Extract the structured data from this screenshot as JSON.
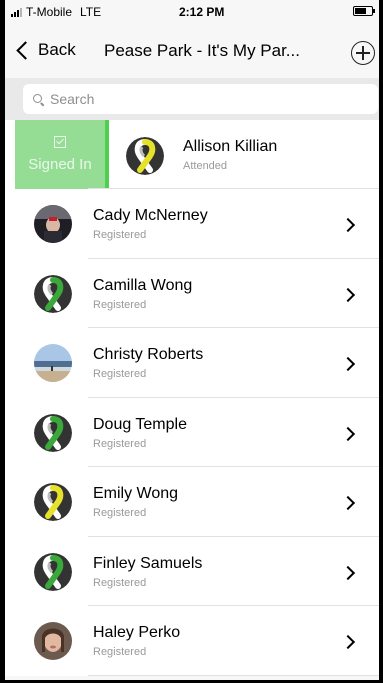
{
  "status_bar": {
    "carrier": "T-Mobile",
    "network": "LTE",
    "time": "2:12 PM"
  },
  "nav": {
    "back_label": "Back",
    "title": "Pease Park - It's My Par..."
  },
  "search": {
    "placeholder": "Search"
  },
  "swipe_action": {
    "label": "Signed In"
  },
  "rows": [
    {
      "name": "Allison Killian",
      "status": "Attended",
      "avatar": "ribbon-yellow"
    },
    {
      "name": "Cady McNerney",
      "status": "Registered",
      "avatar": "photo-person-dark"
    },
    {
      "name": "Camilla Wong",
      "status": "Registered",
      "avatar": "ribbon-green"
    },
    {
      "name": "Christy Roberts",
      "status": "Registered",
      "avatar": "photo-beach"
    },
    {
      "name": "Doug Temple",
      "status": "Registered",
      "avatar": "ribbon-green"
    },
    {
      "name": "Emily Wong",
      "status": "Registered",
      "avatar": "ribbon-yellow"
    },
    {
      "name": "Finley Samuels",
      "status": "Registered",
      "avatar": "ribbon-green"
    },
    {
      "name": "Haley Perko",
      "status": "Registered",
      "avatar": "photo-person-light"
    }
  ],
  "colors": {
    "signed_in_bg": "#95dd95",
    "signed_in_edge": "#4fcf4f",
    "ribbon_green": "#3aa83a",
    "ribbon_yellow": "#e6e12a"
  }
}
